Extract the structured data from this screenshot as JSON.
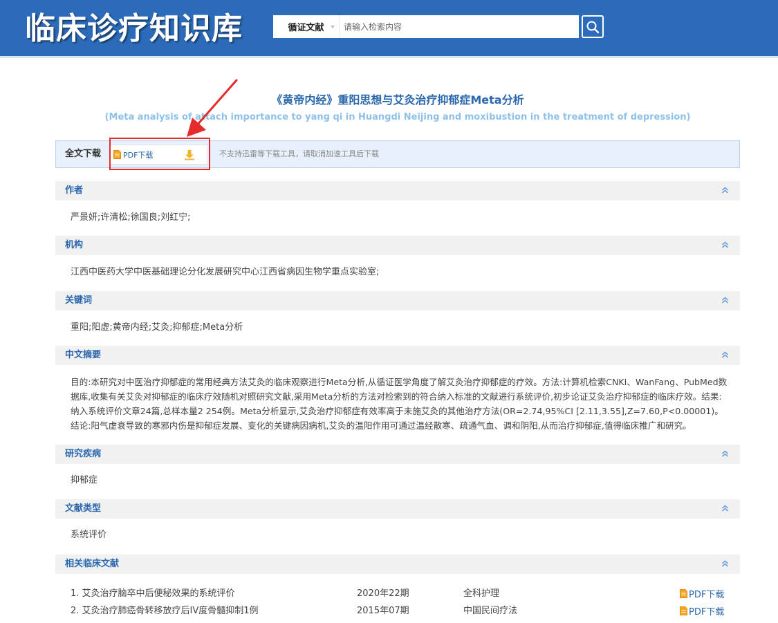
{
  "header": {
    "logo": "临床诊疗知识库",
    "search_type": "循证文献",
    "search_placeholder": "请输入检索内容"
  },
  "article": {
    "title_cn": "《黄帝内经》重阳思想与艾灸治疗抑郁症Meta分析",
    "title_en": "(Meta analysis of attach importance to yang qi in Huangdi Neijing and moxibustion in the treatment of depression)"
  },
  "download": {
    "label": "全文下载",
    "pdf_label": "PDF下载",
    "note": "不支持迅雷等下载工具，请取消加速工具后下载"
  },
  "sections": [
    {
      "title": "作者",
      "content": "严景妍;许清松;徐国良;刘红宁;"
    },
    {
      "title": "机构",
      "content": "江西中医药大学中医基础理论分化发展研究中心江西省病因生物学重点实验室;"
    },
    {
      "title": "关键词",
      "content": "重阳;阳虚;黄帝内经;艾灸;抑郁症;Meta分析"
    },
    {
      "title": "中文摘要",
      "content": "目的:本研究对中医治疗抑郁症的常用经典方法艾灸的临床观察进行Meta分析,从循证医学角度了解艾灸治疗抑郁症的疗效。方法:计算机检索CNKI、WanFang、PubMed数据库,收集有关艾灸对抑郁症的临床疗效随机对照研究文献,采用Meta分析的方法对检索到的符合纳入标准的文献进行系统评价,初步论证艾灸治疗抑郁症的临床疗效。结果:纳入系统评价文章24篇,总样本量2 254例。Meta分析显示,艾灸治疗抑郁症有效率高于未施艾灸的其他治疗方法(OR=2.74,95%CI [2.11,3.55],Z=7.60,P<0.00001)。结论:阳气虚衰导致的寒邪内伤是抑郁症发展、变化的关键病因病机,艾灸的温阳作用可通过温经散寒、疏通气血、调和阴阳,从而治疗抑郁症,值得临床推广和研究。"
    },
    {
      "title": "研究疾病",
      "content": "抑郁症"
    },
    {
      "title": "文献类型",
      "content": "系统评价"
    },
    {
      "title": "相关临床文献",
      "content": ""
    }
  ],
  "related": [
    {
      "title": "1.  艾灸治疗脑卒中后便秘效果的系统评价",
      "issue": "2020年22期",
      "journal": "全科护理",
      "pdf": "PDF下载"
    },
    {
      "title": "2.  艾灸治疗肺癌骨转移放疗后IV度骨髓抑制1例",
      "issue": "2015年07期",
      "journal": "中国民间疗法",
      "pdf": "PDF下载"
    }
  ],
  "colors": {
    "header_bg": "#2b6bb9",
    "accent": "#2b67ad",
    "subtitle": "#8ec1ea",
    "highlight": "#e52b2b",
    "download_icon": "#f0b429"
  }
}
